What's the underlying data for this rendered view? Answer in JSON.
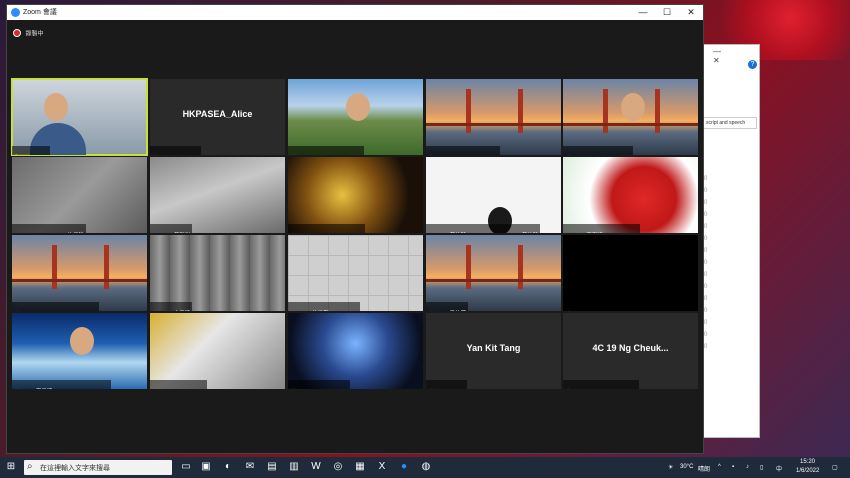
{
  "window": {
    "title": "Zoom 會議"
  },
  "recording": {
    "label": "錄製中"
  },
  "participants": [
    {
      "name": "Alfred Chan",
      "type": "camera",
      "bg": "bg-cam",
      "active": true
    },
    {
      "name": "HKPASEA_Alice",
      "type": "name-only",
      "display": "HKPASEA_Alice",
      "bg": "bg-plain"
    },
    {
      "name": "4C 15 Luk Pang Ming Ming",
      "type": "camera",
      "bg": "bg-mountain"
    },
    {
      "name": "4B 25 Winnie Wu Shing Yi",
      "type": "camera",
      "bg": "bg-bridge"
    },
    {
      "name": "4B 09 Cheung Ming Wei",
      "type": "camera",
      "bg": "bg-bridge"
    },
    {
      "name": "2B 05 Hui Tsz Lam 許子琳",
      "type": "camera",
      "bg": "bg-grey"
    },
    {
      "name": "4B 30 黃新彤",
      "type": "camera",
      "bg": "bg-grey2"
    },
    {
      "name": "4B 31 Timothy Kong Ho Yin",
      "type": "camera",
      "bg": "bg-gold"
    },
    {
      "name": "4A 22 黃柏翰 WONG PO CHEUNG 黃柏翰",
      "type": "camera",
      "bg": "bg-white"
    },
    {
      "name": "3A 11 莫嘉瑤 MOK KA YAU",
      "type": "camera",
      "bg": "bg-straw"
    },
    {
      "name": "4B 30 Newton Tsang Hing Tong",
      "type": "camera",
      "bg": "bg-bridge"
    },
    {
      "name": "5A 06 史子晴",
      "type": "camera",
      "bg": "bg-curtain"
    },
    {
      "name": "5C 07 許浩賢 Tsui Ho Yin",
      "type": "camera",
      "bg": "bg-tiles"
    },
    {
      "name": "3A 20 吳柏灝",
      "type": "camera",
      "bg": "bg-bridge"
    },
    {
      "name": "4C 02 Tong Yuk Man",
      "type": "camera",
      "bg": "bg-black"
    },
    {
      "name": "3E 10 李子晴 LEE TSZ CHING Alice",
      "type": "camera",
      "bg": "bg-sea"
    },
    {
      "name": "5A 28 Choi Tsz Yan",
      "type": "camera",
      "bg": "bg-cat"
    },
    {
      "name": "3A 02 Tong Hoi Chun",
      "type": "camera",
      "bg": "bg-space"
    },
    {
      "name": "Yan Kit Tang",
      "type": "name-only",
      "display": "Yan Kit Tang",
      "bg": "bg-plain"
    },
    {
      "name": "4C 19 Ng Cheuk Kiu Travis",
      "type": "name-only",
      "display": "4C 19 Ng Cheuk...",
      "bg": "bg-plain"
    }
  ],
  "bg_window": {
    "input_text": "script and speech",
    "help": "?",
    "list": [
      "0",
      "0",
      "0",
      "0",
      "0",
      "0",
      "0",
      "0",
      "0",
      "0",
      "0",
      "0",
      "0",
      "0",
      "0"
    ]
  },
  "taskbar": {
    "search_placeholder": "在這裡輸入文字來搜尋",
    "temperature": "30°C",
    "weather": "晴朗",
    "language": "中",
    "time": "15:20",
    "date": "1/6/2022"
  },
  "colors": {
    "active_speaker": "#c9e03a",
    "mic_muted": "#e02525",
    "zoom_blue": "#2d8cff"
  }
}
